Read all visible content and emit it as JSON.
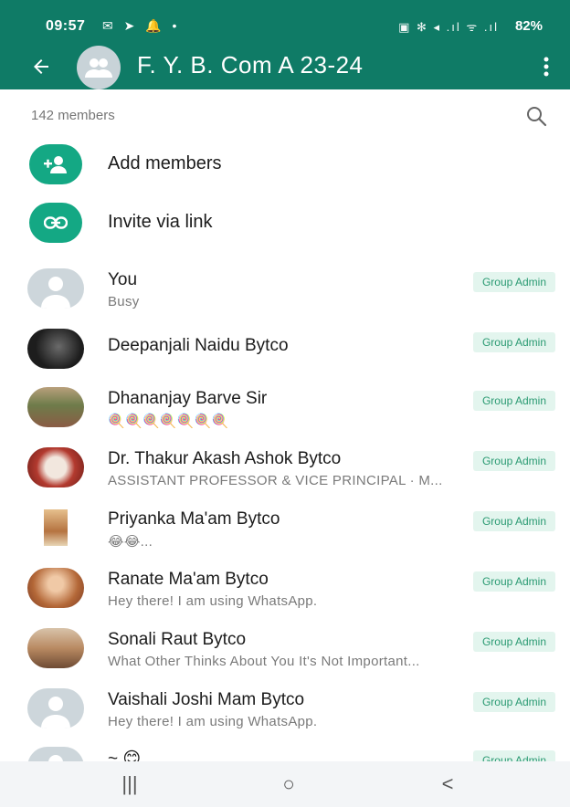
{
  "status_bar": {
    "time": "09:57",
    "left_icons": "✉ ➤ 🔔 •",
    "right_icons": "▣ ✻ ◂ .ıl ᯤ .ıl",
    "battery": "82%"
  },
  "header": {
    "title": "F. Y. B. Com A 23-24",
    "back_icon": "arrow-left-icon",
    "menu_icon": "more-vertical-icon",
    "bg_color": "#0f7b66"
  },
  "members": {
    "count_label": "142 members",
    "search_icon": "search-icon"
  },
  "actions": [
    {
      "label": "Add members",
      "icon": "add-person-icon"
    },
    {
      "label": "Invite via link",
      "icon": "link-icon"
    }
  ],
  "list": [
    {
      "name": "You",
      "sub": "Busy",
      "badge": "Group Admin"
    },
    {
      "name": "Deepanjali Naidu Bytco",
      "sub": "",
      "badge": "Group Admin"
    },
    {
      "name": "Dhananjay Barve Sir",
      "sub": "🍭🍭🍭🍭🍭🍭🍭",
      "badge": "Group Admin"
    },
    {
      "name": "Dr. Thakur Akash Ashok Bytco",
      "sub": "ASSISTANT PROFESSOR & VICE PRINCIPAL · M...",
      "badge": "Group Admin"
    },
    {
      "name": "Priyanka Ma'am Bytco",
      "sub": "😂😂...",
      "badge": "Group Admin"
    },
    {
      "name": "Ranate Ma'am Bytco",
      "sub": "Hey there! I am using WhatsApp.",
      "badge": "Group Admin"
    },
    {
      "name": "Sonali Raut Bytco",
      "sub": "What Other Thinks About You It's Not Important...",
      "badge": "Group Admin"
    },
    {
      "name": "Vaishali Joshi Mam Bytco",
      "sub": "Hey there! I am using WhatsApp.",
      "badge": "Group Admin"
    },
    {
      "name": "~ 😊",
      "sub": "",
      "badge": "Group Admin"
    }
  ],
  "navbar": {
    "recents": "|||",
    "home": "○",
    "back": "<"
  }
}
